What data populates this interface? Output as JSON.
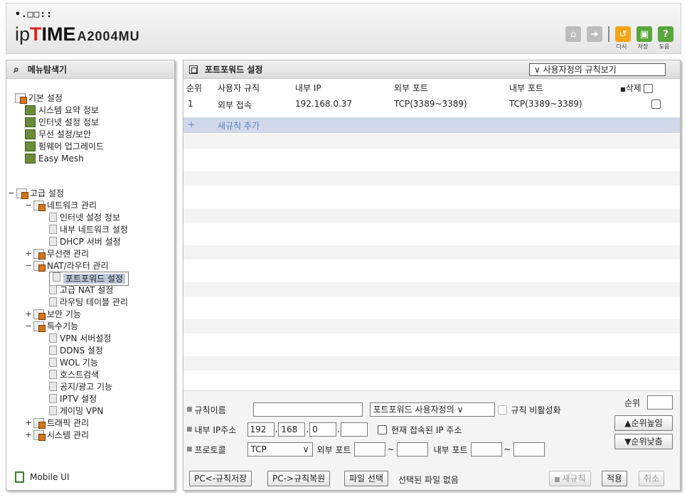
{
  "header": {
    "logo_dots": "•.□□::",
    "logo_ip": "ip",
    "logo_t": "T",
    "logo_ime": "IME",
    "model": "A2004MU",
    "icon_labels": [
      "다시",
      "저장",
      "도움"
    ]
  },
  "menu": {
    "title": "메뉴탐색기",
    "basic": {
      "label": "기본 설정",
      "items": [
        "시스템 요약 정보",
        "인터넷 설정 정보",
        "무선 설정/보안",
        "펌웨어 업그레이드",
        "Easy Mesh"
      ]
    },
    "advanced": {
      "label": "고급 설정",
      "network": {
        "label": "네트워크 관리",
        "items": [
          "인터넷 설정 정보",
          "내부 네트워크 설정",
          "DHCP 서버 설정"
        ]
      },
      "wireless": "무선랜 관리",
      "nat": {
        "label": "NAT/라우터 관리",
        "items": [
          "포트포워드 설정",
          "고급 NAT 설정",
          "라우팅 테이블 관리"
        ]
      },
      "security": "보안 기능",
      "special": {
        "label": "특수기능",
        "items": [
          "VPN 서버설정",
          "DDNS 설정",
          "WOL 기능",
          "호스트검색",
          "공지/광고 기능",
          "IPTV 설정",
          "게이밍 VPN"
        ]
      },
      "traffic": "트래픽 관리",
      "system": "시스템 관리"
    },
    "mobile_ui": "Mobile UI"
  },
  "panel": {
    "title": "포트포워드 설정",
    "view_select": "사용자정의 규칙보기",
    "columns": {
      "no": "순위",
      "rule": "사용자 규칙",
      "inner_ip": "내부 IP",
      "ext_port": "외부 포트",
      "int_port": "내부 포트",
      "delete": "삭제"
    },
    "rows": [
      {
        "no": "1",
        "rule": "외부 접속",
        "inner_ip": "192.168.0.37",
        "ext_port": "TCP(3389~3389)",
        "int_port": "TCP(3389~3389)"
      }
    ],
    "add_row": {
      "plus": "+",
      "label": "새규칙 추가"
    }
  },
  "form": {
    "rule_name_label": "규칙이름",
    "rule_name_value": "",
    "rule_type": "포트포워드 사용자정의",
    "disable_label": "규칙 비활성화",
    "inner_ip_label": "내부 IP주소",
    "ip": [
      "192",
      "168",
      "0",
      ""
    ],
    "current_ip_label": "현재 접속된 IP 주소",
    "protocol_label": "프로토콜",
    "protocol": "TCP",
    "ext_port_label": "외부 포트",
    "int_port_label": "내부 포트",
    "rank_label": "순위",
    "rank_up": "▲순위높임",
    "rank_down": "▼순위낮춤",
    "tilde": "~"
  },
  "buttons": {
    "pc_save": "PC<-규칙저장",
    "pc_restore": "PC->규칙복원",
    "file_select": "파일 선택",
    "no_file": "선택된 파일 없음",
    "new_rule": "새규칙",
    "apply": "적용",
    "cancel": "취소"
  }
}
